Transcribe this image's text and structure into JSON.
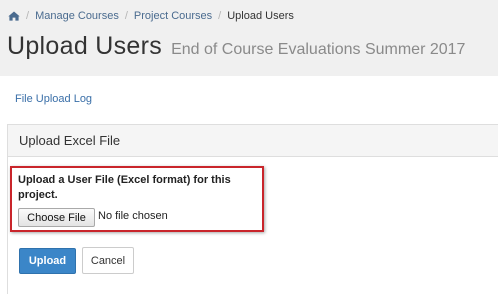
{
  "breadcrumb": {
    "home_icon": "home-icon",
    "items": [
      "Manage Courses",
      "Project Courses"
    ],
    "current": "Upload Users",
    "separator": "/"
  },
  "header": {
    "title": "Upload Users",
    "subtitle": "End of Course Evaluations Summer 2017"
  },
  "links": {
    "file_upload_log": "File Upload Log"
  },
  "panel": {
    "heading": "Upload Excel File",
    "field_label": "Upload a User File (Excel format) for this project.",
    "choose_file_label": "Choose File",
    "no_file_text": "No file chosen"
  },
  "actions": {
    "upload_label": "Upload",
    "cancel_label": "Cancel"
  },
  "colors": {
    "primary": "#3b86c8",
    "highlight_border": "#c9252b",
    "link": "#3a6fa8"
  }
}
